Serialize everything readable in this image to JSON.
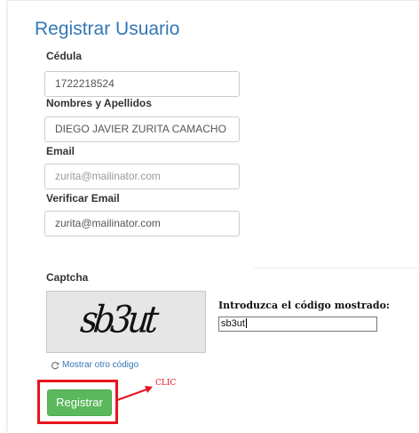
{
  "form": {
    "title": "Registrar Usuario",
    "fields": [
      {
        "label": "Cédula",
        "value": "1722218524",
        "placeholder": ""
      },
      {
        "label": "Nombres y Apellidos",
        "value": "DIEGO JAVIER ZURITA CAMACHO",
        "placeholder": ""
      },
      {
        "label": "Email",
        "value": "",
        "placeholder": "zurita@mailinator.com"
      },
      {
        "label": "Verificar Email",
        "value": "zurita@mailinator.com",
        "placeholder": ""
      }
    ],
    "captcha": {
      "label": "Captcha",
      "image_text": "sb3ut",
      "hint": "Introduzca el código mostrado:",
      "input_value": "sb3ut",
      "refresh_label": "Mostrar otro código"
    },
    "submit_label": "Registrar",
    "annotation": "CLIC"
  },
  "colors": {
    "title": "#3377b5",
    "button": "#5cb85c",
    "highlight": "#e8141e",
    "link": "#3377b5"
  },
  "icons": {
    "refresh": "refresh-icon",
    "arrow": "arrow-icon"
  }
}
